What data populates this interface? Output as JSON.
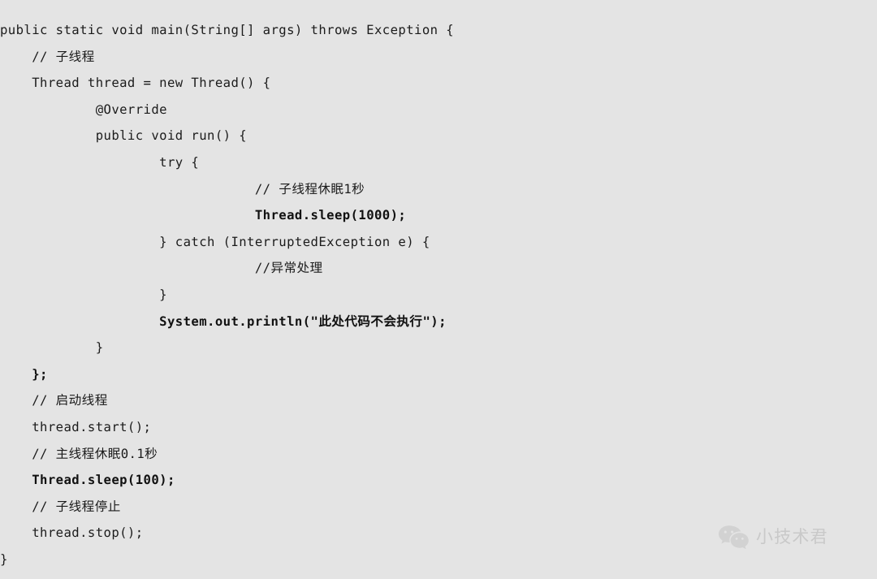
{
  "background_color": "#e4e4e4",
  "text_color": "#1b1b1b",
  "code": {
    "language": "Java",
    "lines": [
      {
        "indent": "",
        "text": "public static void main(String[] args) throws Exception {",
        "bold": false
      },
      {
        "indent": "    ",
        "text": "// 子线程",
        "bold": false
      },
      {
        "indent": "    ",
        "text": "Thread thread = new Thread() {",
        "bold": false
      },
      {
        "indent": "            ",
        "text": "@Override",
        "bold": false
      },
      {
        "indent": "            ",
        "text": "public void run() {",
        "bold": false
      },
      {
        "indent": "                    ",
        "text": "try {",
        "bold": false
      },
      {
        "indent": "                                ",
        "text": "// 子线程休眠1秒",
        "bold": false
      },
      {
        "indent": "                                ",
        "text": "Thread.sleep(1000);",
        "bold": true
      },
      {
        "indent": "                    ",
        "text": "} catch (InterruptedException e) {",
        "bold": false
      },
      {
        "indent": "                                ",
        "text": "//异常处理",
        "bold": false
      },
      {
        "indent": "                    ",
        "text": "}",
        "bold": false
      },
      {
        "indent": "                    ",
        "text": "System.out.println(\"此处代码不会执行\");",
        "bold": true
      },
      {
        "indent": "            ",
        "text": "}",
        "bold": false
      },
      {
        "indent": "    ",
        "text": "};",
        "bold": true
      },
      {
        "indent": "    ",
        "text": "// 启动线程",
        "bold": false
      },
      {
        "indent": "    ",
        "text": "thread.start();",
        "bold": false
      },
      {
        "indent": "    ",
        "text": "// 主线程休眠0.1秒",
        "bold": false
      },
      {
        "indent": "    ",
        "text": "Thread.sleep(100);",
        "bold": true
      },
      {
        "indent": "    ",
        "text": "// 子线程停止",
        "bold": false
      },
      {
        "indent": "    ",
        "text": "thread.stop();",
        "bold": false
      },
      {
        "indent": "",
        "text": "}",
        "bold": false
      }
    ]
  },
  "watermark": {
    "icon": "wechat-icon",
    "label": "小技术君",
    "color": "#c9c9c9"
  }
}
